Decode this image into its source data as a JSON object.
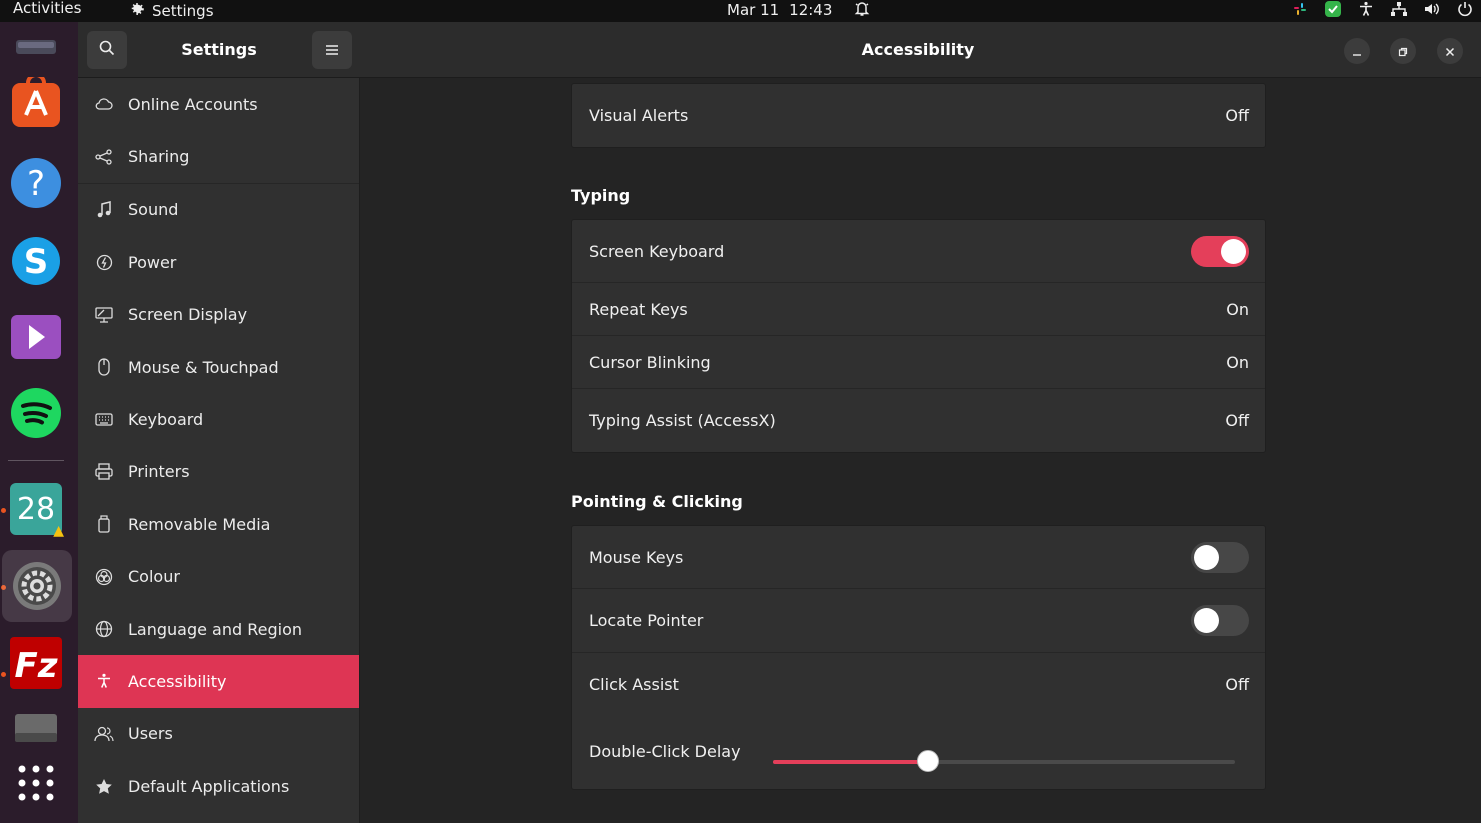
{
  "topbar": {
    "activities": "Activities",
    "app_name": "Settings",
    "date": "Mar 11",
    "time": "12:43"
  },
  "dock": {
    "calendar_day": "28"
  },
  "sidebar": {
    "title": "Settings",
    "items": [
      {
        "label": "Online Accounts",
        "icon": "cloud-icon"
      },
      {
        "label": "Sharing",
        "icon": "share-icon"
      },
      {
        "label": "Sound",
        "icon": "music-note-icon"
      },
      {
        "label": "Power",
        "icon": "power-icon"
      },
      {
        "label": "Screen Display",
        "icon": "display-icon"
      },
      {
        "label": "Mouse & Touchpad",
        "icon": "mouse-icon"
      },
      {
        "label": "Keyboard",
        "icon": "keyboard-icon"
      },
      {
        "label": "Printers",
        "icon": "printer-icon"
      },
      {
        "label": "Removable Media",
        "icon": "removable-media-icon"
      },
      {
        "label": "Colour",
        "icon": "colour-icon"
      },
      {
        "label": "Language and Region",
        "icon": "globe-icon"
      },
      {
        "label": "Accessibility",
        "icon": "accessibility-icon",
        "selected": true
      },
      {
        "label": "Users",
        "icon": "users-icon"
      },
      {
        "label": "Default Applications",
        "icon": "star-icon"
      }
    ]
  },
  "main": {
    "title": "Accessibility",
    "visual_alerts": {
      "label": "Visual Alerts",
      "value": "Off"
    },
    "typing": {
      "heading": "Typing",
      "screen_keyboard": {
        "label": "Screen Keyboard",
        "on": true
      },
      "repeat_keys": {
        "label": "Repeat Keys",
        "value": "On"
      },
      "cursor_blinking": {
        "label": "Cursor Blinking",
        "value": "On"
      },
      "typing_assist": {
        "label": "Typing Assist (AccessX)",
        "value": "Off"
      }
    },
    "pointing": {
      "heading": "Pointing & Clicking",
      "mouse_keys": {
        "label": "Mouse Keys",
        "on": false
      },
      "locate_pointer": {
        "label": "Locate Pointer",
        "on": false
      },
      "click_assist": {
        "label": "Click Assist",
        "value": "Off"
      },
      "double_click_delay": {
        "label": "Double-Click Delay",
        "fraction": 0.335
      }
    }
  },
  "colors": {
    "accent": "#e43f5a",
    "selected_sidebar": "#de3554",
    "dock_bg": "#2b1c2b",
    "window_bg": "#242424",
    "panel_bg": "#303030"
  }
}
